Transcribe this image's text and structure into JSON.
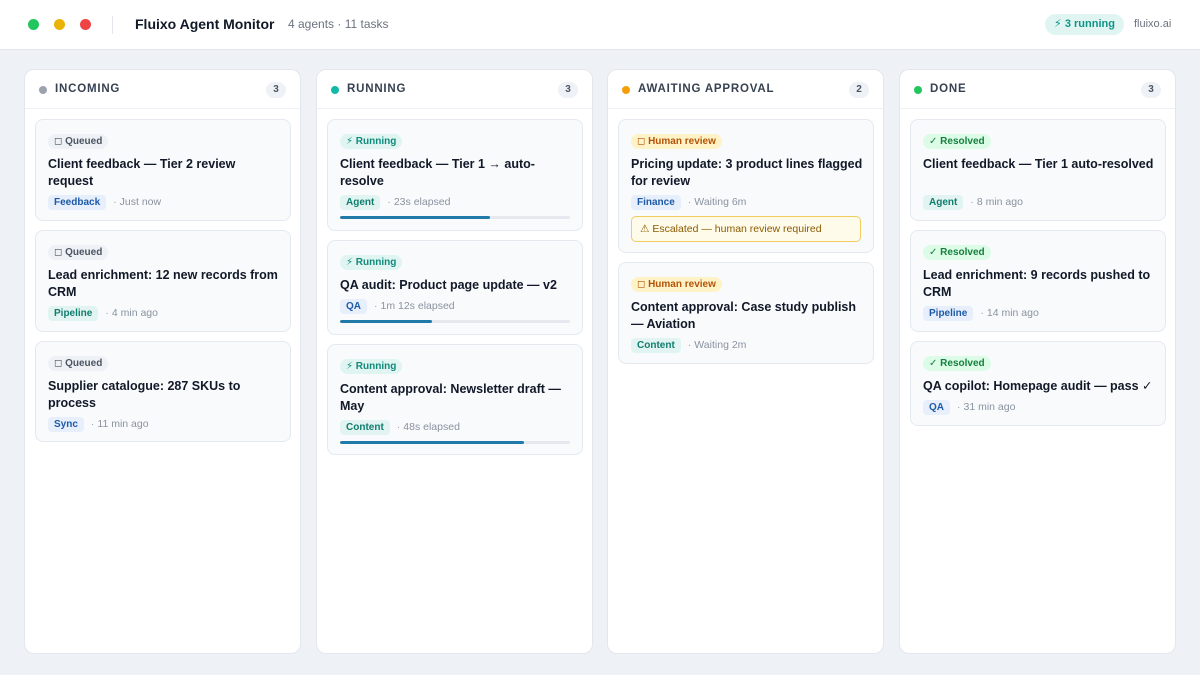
{
  "window": {
    "controls": [
      {
        "name": "green",
        "color": "#22c55e"
      },
      {
        "name": "yellow",
        "color": "#eab308"
      },
      {
        "name": "red",
        "color": "#ef4444"
      }
    ]
  },
  "header": {
    "title": "Fluixo Agent Monitor",
    "subtitle": "4 agents · 11 tasks",
    "running_pill": {
      "label": "⚡ 3 running",
      "color": "#0f9488",
      "bg": "#e0f5f2"
    },
    "brand": "fluixo.ai"
  },
  "columns": [
    {
      "title": "INCOMING",
      "count": "3",
      "dot_color": "#9ca3af",
      "cards": [
        {
          "badge": "◻ Queued",
          "badge_style": "queued",
          "title": "Client feedback — Tier 2 review request",
          "tag": "Feedback",
          "tag_style": "blue",
          "time": "Just now"
        },
        {
          "badge": "◻ Queued",
          "badge_style": "queued",
          "title": "Lead enrichment: 12 new records from CRM",
          "tag": "Pipeline",
          "tag_style": "teal",
          "time": "4 min ago"
        },
        {
          "badge": "◻ Queued",
          "badge_style": "queued",
          "title": "Supplier catalogue: 287 SKUs to process",
          "tag": "Sync",
          "tag_style": "blue",
          "time": "11 min ago"
        }
      ]
    },
    {
      "title": "RUNNING",
      "count": "3",
      "dot_color": "#14b8a6",
      "cards": [
        {
          "badge": "⚡ Running",
          "badge_style": "running",
          "title": "Client feedback — Tier 1 → auto-resolve",
          "tag": "Agent",
          "tag_style": "teal",
          "time": "23s elapsed",
          "progress": 0.65
        },
        {
          "badge": "⚡ Running",
          "badge_style": "running",
          "title": "QA audit: Product page update — v2",
          "tag": "QA",
          "tag_style": "blue",
          "time": "1m 12s elapsed",
          "progress": 0.4
        },
        {
          "badge": "⚡ Running",
          "badge_style": "running",
          "title": "Content approval: Newsletter draft — May",
          "tag": "Content",
          "tag_style": "teal",
          "time": "48s elapsed",
          "progress": 0.8
        }
      ]
    },
    {
      "title": "AWAITING APPROVAL",
      "count": "2",
      "dot_color": "#f59e0b",
      "cards": [
        {
          "badge": "◻ Human review",
          "badge_style": "review",
          "title": "Pricing update: 3 product lines flagged for review",
          "tag": "Finance",
          "tag_style": "blue",
          "time": "Waiting 6m",
          "escalation": "⚠ Escalated — human review required"
        },
        {
          "badge": "◻ Human review",
          "badge_style": "review",
          "title": "Content approval: Case study publish — Aviation",
          "tag": "Content",
          "tag_style": "teal",
          "time": "Waiting 2m"
        }
      ]
    },
    {
      "title": "DONE",
      "count": "3",
      "dot_color": "#22c55e",
      "cards": [
        {
          "badge": "✓ Resolved",
          "badge_style": "resolved",
          "title": "Client feedback — Tier 1 auto-resolved",
          "tag": "Agent",
          "tag_style": "teal",
          "time": "8 min ago"
        },
        {
          "badge": "✓ Resolved",
          "badge_style": "resolved",
          "title": "Lead enrichment: 9 records pushed to CRM",
          "tag": "Pipeline",
          "tag_style": "blue",
          "time": "14 min ago"
        },
        {
          "badge": "✓ Resolved",
          "badge_style": "resolved",
          "title": "QA copilot: Homepage audit — pass ✓",
          "tag": "QA",
          "tag_style": "blue",
          "time": "31 min ago"
        }
      ]
    }
  ],
  "badge_colors": {
    "queued": {
      "bg": "#eef1f5",
      "fg": "#4b5563"
    },
    "running": {
      "bg": "#e0f5f2",
      "fg": "#0f8a7b"
    },
    "review": {
      "bg": "#fef3c7",
      "fg": "#b45309"
    },
    "resolved": {
      "bg": "#dcfce7",
      "fg": "#15803d"
    }
  }
}
